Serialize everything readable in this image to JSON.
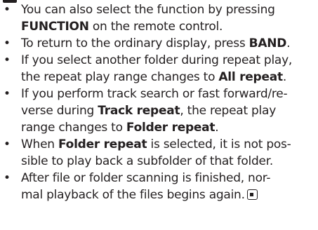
{
  "notes": {
    "bullet": "•",
    "item1": {
      "line1": "You can also select the function by pressing",
      "bold": "FUNCTION",
      "rest": " on the remote control."
    },
    "item2": {
      "text": "To return to the ordinary display, press ",
      "bold": "BAND",
      "end": "."
    },
    "item3": {
      "line1": "If you select another folder during repeat play,",
      "text": "the repeat play range changes to ",
      "bold": "All repeat",
      "end": "."
    },
    "item4": {
      "line1": "If you perform track search or fast forward/re-",
      "text": "verse during ",
      "bold1": "Track repeat",
      "mid": ", the repeat play",
      "line3": "range changes to ",
      "bold2": "Folder repeat",
      "end": "."
    },
    "item5": {
      "text": "When ",
      "bold": "Folder repeat",
      "mid": " is selected, it is not pos-",
      "line2": "sible to play back a subfolder of that folder."
    },
    "item6": {
      "line1": "After file or folder scanning is finished, nor-",
      "line2": "mal playback of the files begins again."
    }
  },
  "icons": {
    "header_mark": "note-marker-icon",
    "end_mark": "end-of-section-icon"
  }
}
